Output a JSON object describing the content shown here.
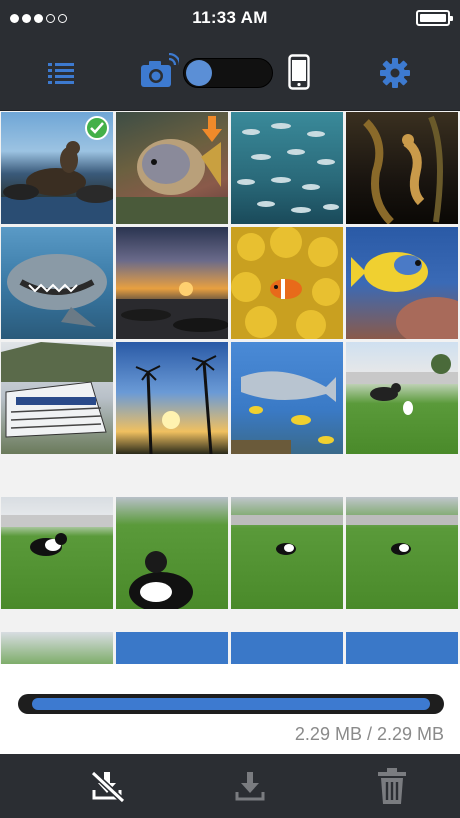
{
  "status_bar": {
    "time": "11:33 AM",
    "signal_dots_filled": 3,
    "signal_dots_total": 5,
    "battery_level": 1.0
  },
  "toolbar": {
    "list_icon": "list-icon",
    "camera_icon": "camera-wifi-icon",
    "phone_icon": "smartphone-icon",
    "settings_icon": "gear-icon",
    "source_toggle_position": "camera",
    "accent": "#3d7ad0"
  },
  "gallery": {
    "tiles": [
      {
        "subject": "sea lion on rocks",
        "selected": true
      },
      {
        "subject": "angelfish on reef",
        "downloading": true
      },
      {
        "subject": "school of fish"
      },
      {
        "subject": "seahorse in seaweed"
      },
      {
        "subject": "shark underwater"
      },
      {
        "subject": "sunset over rocky shore"
      },
      {
        "subject": "clownfish in anemone"
      },
      {
        "subject": "yellow angelfish"
      },
      {
        "subject": "dive boat"
      },
      {
        "subject": "palm trees at sunset"
      },
      {
        "subject": "shark with yellow fish"
      },
      {
        "subject": "dog with frisbee on lawn"
      },
      {
        "subject": "dog on lawn wide angle"
      },
      {
        "subject": "dog close up on lawn"
      },
      {
        "subject": "dog on lawn"
      },
      {
        "subject": "dog on lawn"
      },
      {
        "subject": "lawn"
      },
      {
        "subject": "sky"
      },
      {
        "subject": "sky"
      },
      {
        "subject": "sky"
      }
    ]
  },
  "progress": {
    "fraction": 1.0,
    "text": "2.29 MB / 2.29 MB"
  },
  "bottom_bar": {
    "cancel_download_icon": "download-cancel-icon",
    "download_icon": "download-icon",
    "delete_icon": "trash-icon"
  }
}
